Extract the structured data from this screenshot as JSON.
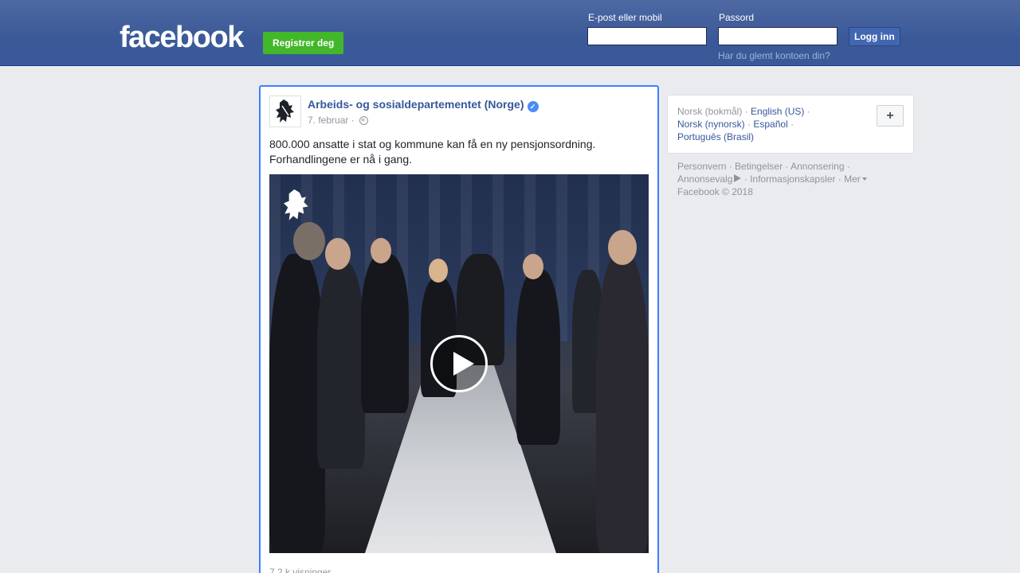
{
  "header": {
    "logo_text": "facebook",
    "register_label": "Registrer deg",
    "email_label": "E-post eller mobil",
    "password_label": "Passord",
    "login_label": "Logg inn",
    "forgot_label": "Har du glemt kontoen din?"
  },
  "post": {
    "page_name": "Arbeids- og sosialdepartementet (Norge)",
    "date": "7. februar",
    "meta_separator": "·",
    "text_line1": "800.000 ansatte i stat og kommune kan få en ny pensjonsordning.",
    "text_line2": "Forhandlingene er nå i gang.",
    "views": "7,2 k visninger"
  },
  "languages": {
    "current": "Norsk (bokmål)",
    "items": [
      "English (US)",
      "Norsk (nynorsk)",
      "Español",
      "Português (Brasil)"
    ],
    "add_label": "+"
  },
  "footer": {
    "links": [
      "Personvern",
      "Betingelser",
      "Annonsering",
      "Annonsevalg",
      "Informasjonskapsler",
      "Mer"
    ],
    "copyright": "Facebook © 2018"
  },
  "colors": {
    "brand_blue": "#3b5998",
    "register_green": "#42b72a",
    "link_blue": "#365899",
    "focus_border": "#4080ff"
  },
  "icons": {
    "verified": "verified-badge-icon",
    "audience": "globe-icon",
    "play": "play-icon",
    "adchoices": "adchoices-icon"
  }
}
